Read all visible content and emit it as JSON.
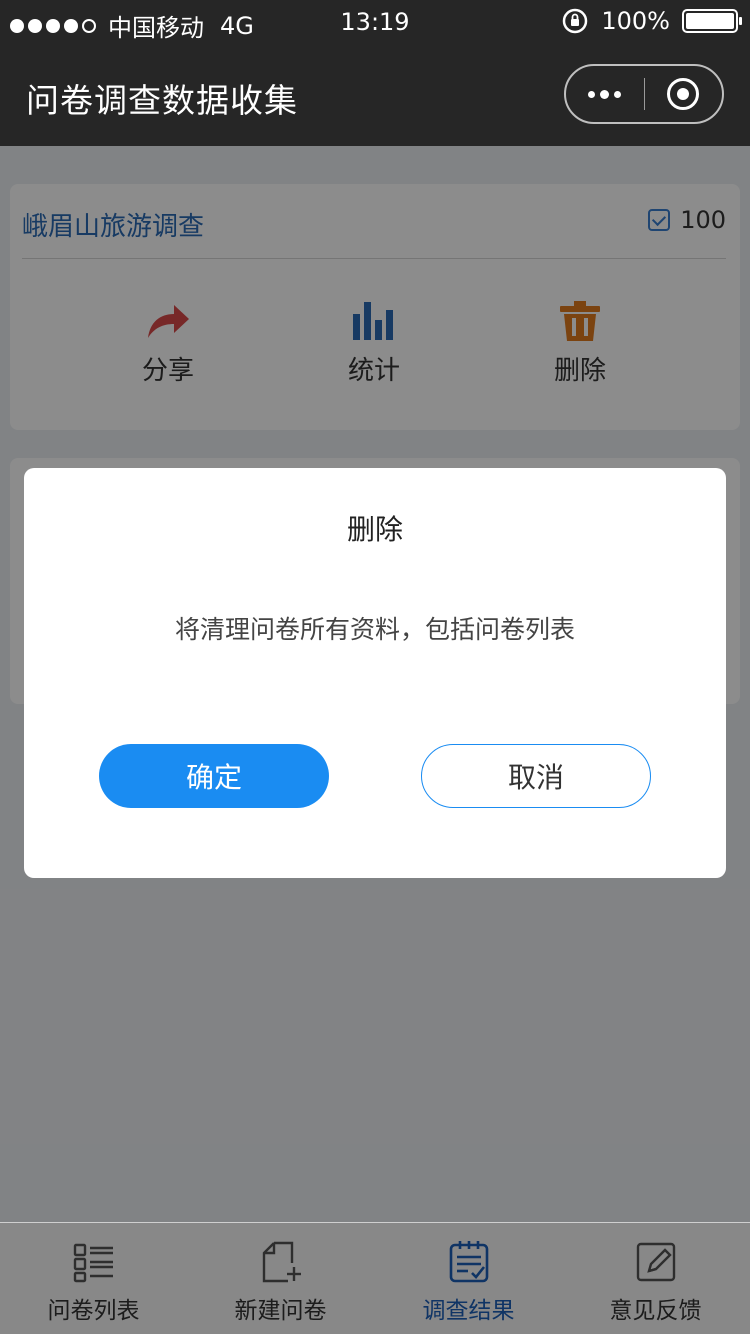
{
  "status_bar": {
    "carrier": "中国移动",
    "network": "4G",
    "time": "13:19",
    "battery": "100%"
  },
  "nav": {
    "title": "问卷调查数据收集",
    "more_icon": "more-dots-icon",
    "close_icon": "target-icon"
  },
  "survey_card": {
    "title": "峨眉山旅游调查",
    "count": "100",
    "actions": [
      {
        "label": "分享",
        "icon": "share-arrow-icon",
        "color": "#d94a4a"
      },
      {
        "label": "统计",
        "icon": "bar-chart-icon",
        "color": "#2a6bb5"
      },
      {
        "label": "删除",
        "icon": "trash-icon",
        "color": "#e07a1e"
      }
    ]
  },
  "dialog": {
    "title": "删除",
    "message": "将清理问卷所有资料，包括问卷列表",
    "confirm_label": "确定",
    "cancel_label": "取消",
    "confirm_color": "#1a8cf2"
  },
  "tab_bar": {
    "tabs": [
      {
        "label": "问卷列表",
        "icon": "list-icon",
        "active": false
      },
      {
        "label": "新建问卷",
        "icon": "new-document-icon",
        "active": false
      },
      {
        "label": "调查结果",
        "icon": "checklist-icon",
        "active": true
      },
      {
        "label": "意见反馈",
        "icon": "edit-icon",
        "active": false
      }
    ]
  }
}
